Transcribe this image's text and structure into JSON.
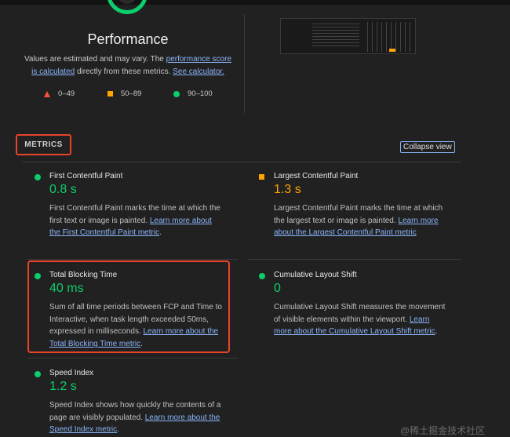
{
  "performance": {
    "title": "Performance",
    "desc_text1": "Values are estimated and may vary. The ",
    "desc_link1": "performance score is calculated",
    "desc_text2": " directly from these metrics. ",
    "desc_link2": "See calculator.",
    "legend": {
      "red": "0–49",
      "orange": "50–89",
      "green": "90–100"
    }
  },
  "metrics_header": {
    "label": "METRICS",
    "collapse_label": "Collapse view"
  },
  "metrics": [
    {
      "title": "First Contentful Paint",
      "value": "0.8 s",
      "status": "green",
      "desc": "First Contentful Paint marks the time at which the first text or image is painted. ",
      "link": "Learn more about the First Contentful Paint metric",
      "after": "."
    },
    {
      "title": "Largest Contentful Paint",
      "value": "1.3 s",
      "status": "orange",
      "desc": "Largest Contentful Paint marks the time at which the largest text or image is painted. ",
      "link": "Learn more about the Largest Contentful Paint metric",
      "after": ""
    },
    {
      "title": "Total Blocking Time",
      "value": "40 ms",
      "status": "green",
      "desc": "Sum of all time periods between FCP and Time to Interactive, when task length exceeded 50ms, expressed in milliseconds. ",
      "link": "Learn more about the Total Blocking Time metric",
      "after": "."
    },
    {
      "title": "Cumulative Layout Shift",
      "value": "0",
      "status": "green",
      "desc": "Cumulative Layout Shift measures the movement of visible elements within the viewport. ",
      "link": "Learn more about the Cumulative Layout Shift metric",
      "after": "."
    },
    {
      "title": "Speed Index",
      "value": "1.2 s",
      "status": "green",
      "desc": "Speed Index shows how quickly the contents of a page are visibly populated. ",
      "link": "Learn more about the Speed Index metric",
      "after": "."
    }
  ],
  "colors": {
    "green": "#0cce6b",
    "orange": "#ffa400",
    "red": "#ff4e42",
    "link": "#8ab4f8",
    "highlight": "#e8442a"
  },
  "watermark": "@稀土掘金技术社区"
}
